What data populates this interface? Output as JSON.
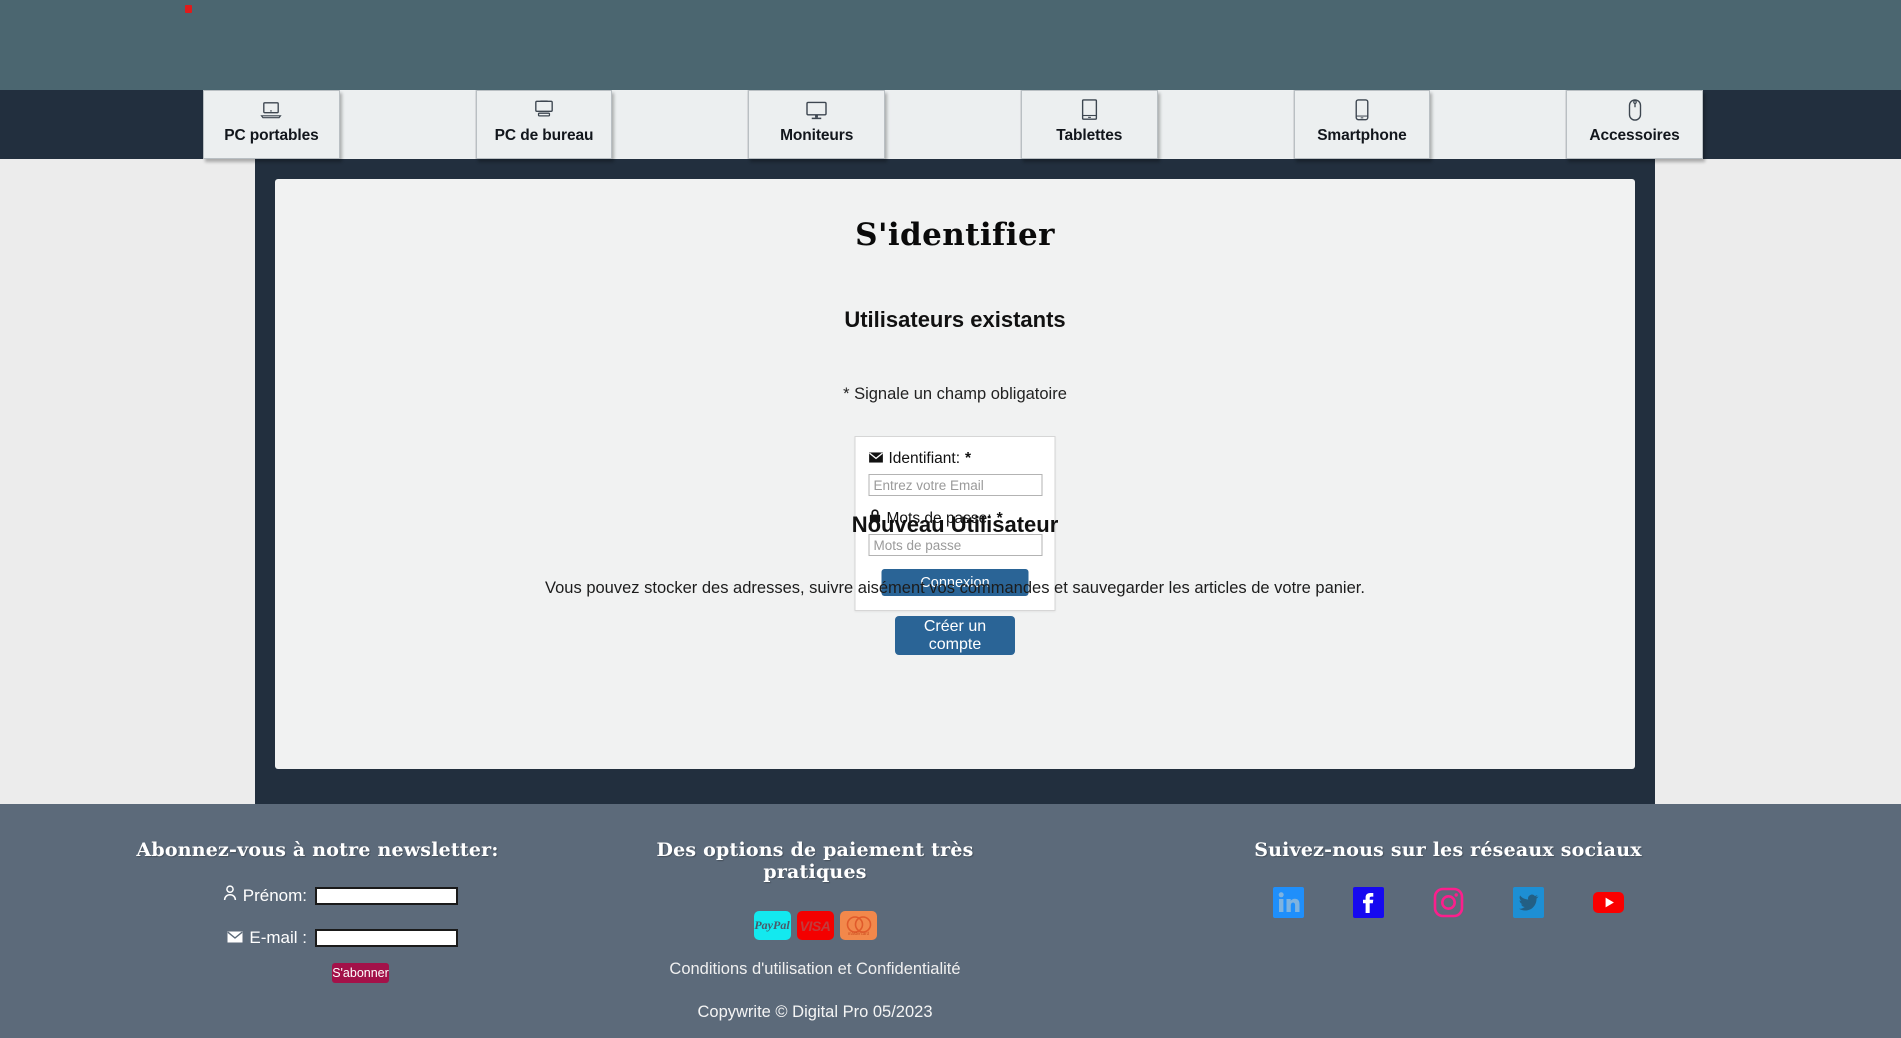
{
  "header": {
    "logo_mark": "red-dot"
  },
  "nav": {
    "items": [
      {
        "label": "PC portables",
        "icon": "laptop-icon",
        "style": "card"
      },
      {
        "label": "",
        "icon": "",
        "style": "plain"
      },
      {
        "label": "PC de bureau",
        "icon": "desktop-icon",
        "style": "card"
      },
      {
        "label": "",
        "icon": "",
        "style": "plain"
      },
      {
        "label": "Moniteurs",
        "icon": "monitor-icon",
        "style": "card"
      },
      {
        "label": "",
        "icon": "",
        "style": "plain"
      },
      {
        "label": "Tablettes",
        "icon": "tablet-icon",
        "style": "card"
      },
      {
        "label": "",
        "icon": "",
        "style": "plain"
      },
      {
        "label": "Smartphone",
        "icon": "mobile-icon",
        "style": "card"
      },
      {
        "label": "",
        "icon": "",
        "style": "plain"
      },
      {
        "label": "Accessoires",
        "icon": "mouse-icon",
        "style": "card"
      }
    ]
  },
  "main": {
    "page_title": "S'identifier",
    "existing_users_title": "Utilisateurs existants",
    "required_note": "* Signale un champ obligatoire",
    "login_form": {
      "identifier_label": "Identifiant:",
      "identifier_required": "*",
      "identifier_icon": "envelope-icon",
      "identifier_placeholder": "Entrez votre Email",
      "identifier_value": "",
      "password_label": "Mots de passe:",
      "password_required": "*",
      "password_icon": "lock-icon",
      "password_placeholder": "Mots de passe",
      "password_value": "",
      "submit_label": "Connexion"
    },
    "new_user": {
      "title": "Nouveau Utilisateur",
      "description": "Vous pouvez stocker des adresses, suivre aisément vos commandes et sauvegarder les articles de votre panier.",
      "create_label": "Créer un compte"
    }
  },
  "footer": {
    "newsletter": {
      "title": "Abonnez-vous à notre newsletter:",
      "firstname_label": "Prénom:",
      "firstname_icon": "person-icon",
      "firstname_value": "",
      "email_label": "E-mail :",
      "email_icon": "envelope-icon",
      "email_value": "",
      "subscribe_label": "S'abonner"
    },
    "payment": {
      "title": "Des options de paiement très pratiques",
      "cards": [
        {
          "name": "paypal-card",
          "text": "PayPal",
          "bg": "#13e9ef"
        },
        {
          "name": "visa-card",
          "text": "VISA",
          "bg": "#f40000"
        },
        {
          "name": "mastercard-card",
          "text": "mastercard",
          "bg": "#f2884b"
        }
      ],
      "terms_label": "Conditions d'utilisation et Confidentialité",
      "copyright": "Copywrite © Digital Pro 05/2023"
    },
    "social": {
      "title": "Suivez-nous sur les réseaux sociaux",
      "icons": [
        {
          "name": "linkedin-icon",
          "color": "#1f8ffb"
        },
        {
          "name": "facebook-icon",
          "color": "#1609f0"
        },
        {
          "name": "instagram-icon",
          "color": "#fb1f8c"
        },
        {
          "name": "twitter-icon",
          "color": "#1d8fd4"
        },
        {
          "name": "youtube-icon",
          "color": "#fa0000"
        }
      ]
    }
  },
  "colors": {
    "header_band": "#4b6670",
    "navbar": "#222f3e",
    "frame": "#222f3e",
    "card": "#f1f2f2",
    "footer": "#5c6a7a",
    "primary_button": "#2a6496",
    "subscribe_button": "#a31149"
  }
}
